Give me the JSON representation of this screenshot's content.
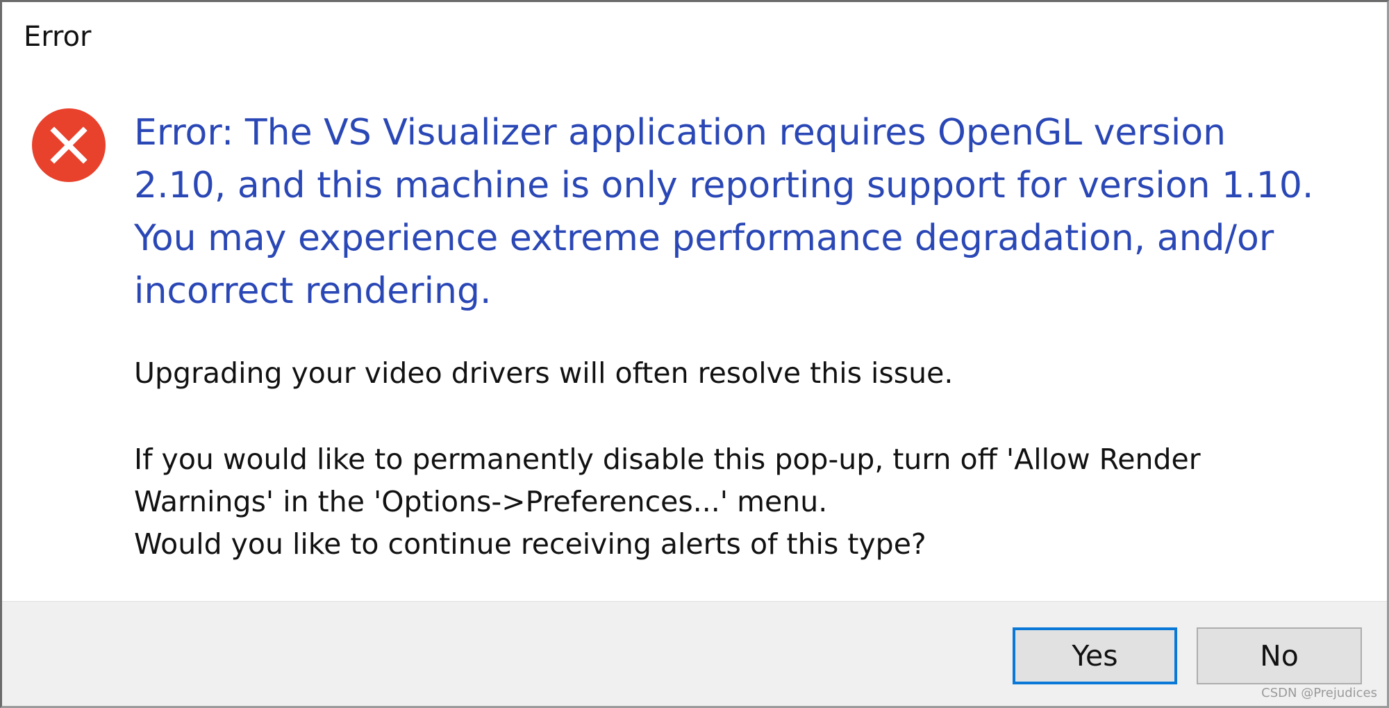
{
  "window": {
    "title": "Error"
  },
  "icon": {
    "name": "error-icon",
    "color": "#e8412c"
  },
  "message": {
    "main": "Error: The VS Visualizer application requires OpenGL version\n2.10, and this machine is only reporting support for version 1.10.\nYou may experience extreme performance degradation, and/or\nincorrect rendering.",
    "hint": "Upgrading your video drivers will often resolve this issue.",
    "question": "If you would like to permanently disable this pop-up, turn off 'Allow Render\nWarnings' in the 'Options->Preferences...' menu.\nWould you like to continue receiving alerts of this type?"
  },
  "buttons": {
    "yes": "Yes",
    "no": "No"
  },
  "watermark": "CSDN @Prejudices",
  "colors": {
    "main_text": "#2a47b6",
    "focus_border": "#0a78d7"
  }
}
